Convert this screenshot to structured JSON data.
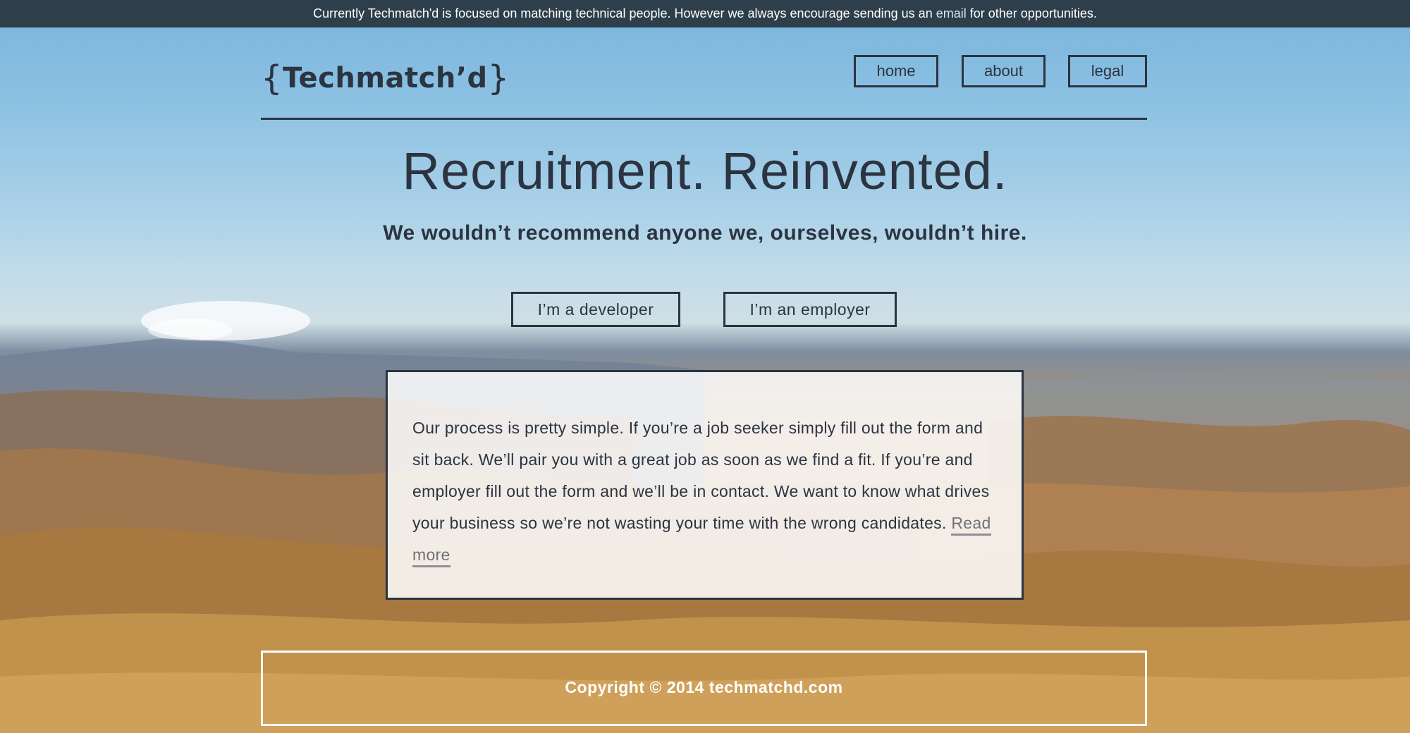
{
  "banner": {
    "text_before": "Currently Techmatch'd is focused on matching technical people. However we always encourage sending us an",
    "email_link": "email",
    "text_after": "for other opportunities."
  },
  "header": {
    "logo": {
      "open_brace": "{",
      "name": "Techmatch’d",
      "close_brace": "}"
    },
    "nav": {
      "home": "home",
      "about": "about",
      "legal": "legal"
    }
  },
  "hero": {
    "title": "Recruitment. Reinvented.",
    "subtitle": "We wouldn’t recommend anyone we, ourselves, wouldn’t hire.",
    "developer_button": "I’m a developer",
    "employer_button": "I’m an employer"
  },
  "process": {
    "text": "Our process is pretty simple. If you’re a job seeker simply fill out the form and sit back. We’ll pair you with a great job as soon as we find a fit. If you’re and employer fill out the form and we’ll be in contact. We want to know what drives your business so we’re not wasting your time with the wrong candidates.",
    "read_more": "Read more"
  },
  "footer": {
    "copyright": "Copyright © 2014 techmatchd.com"
  },
  "colors": {
    "banner_bg": "#2e3f4b",
    "text_dark": "#2b3440",
    "box_bg": "#ffffff",
    "read_more": "#6f7378"
  }
}
